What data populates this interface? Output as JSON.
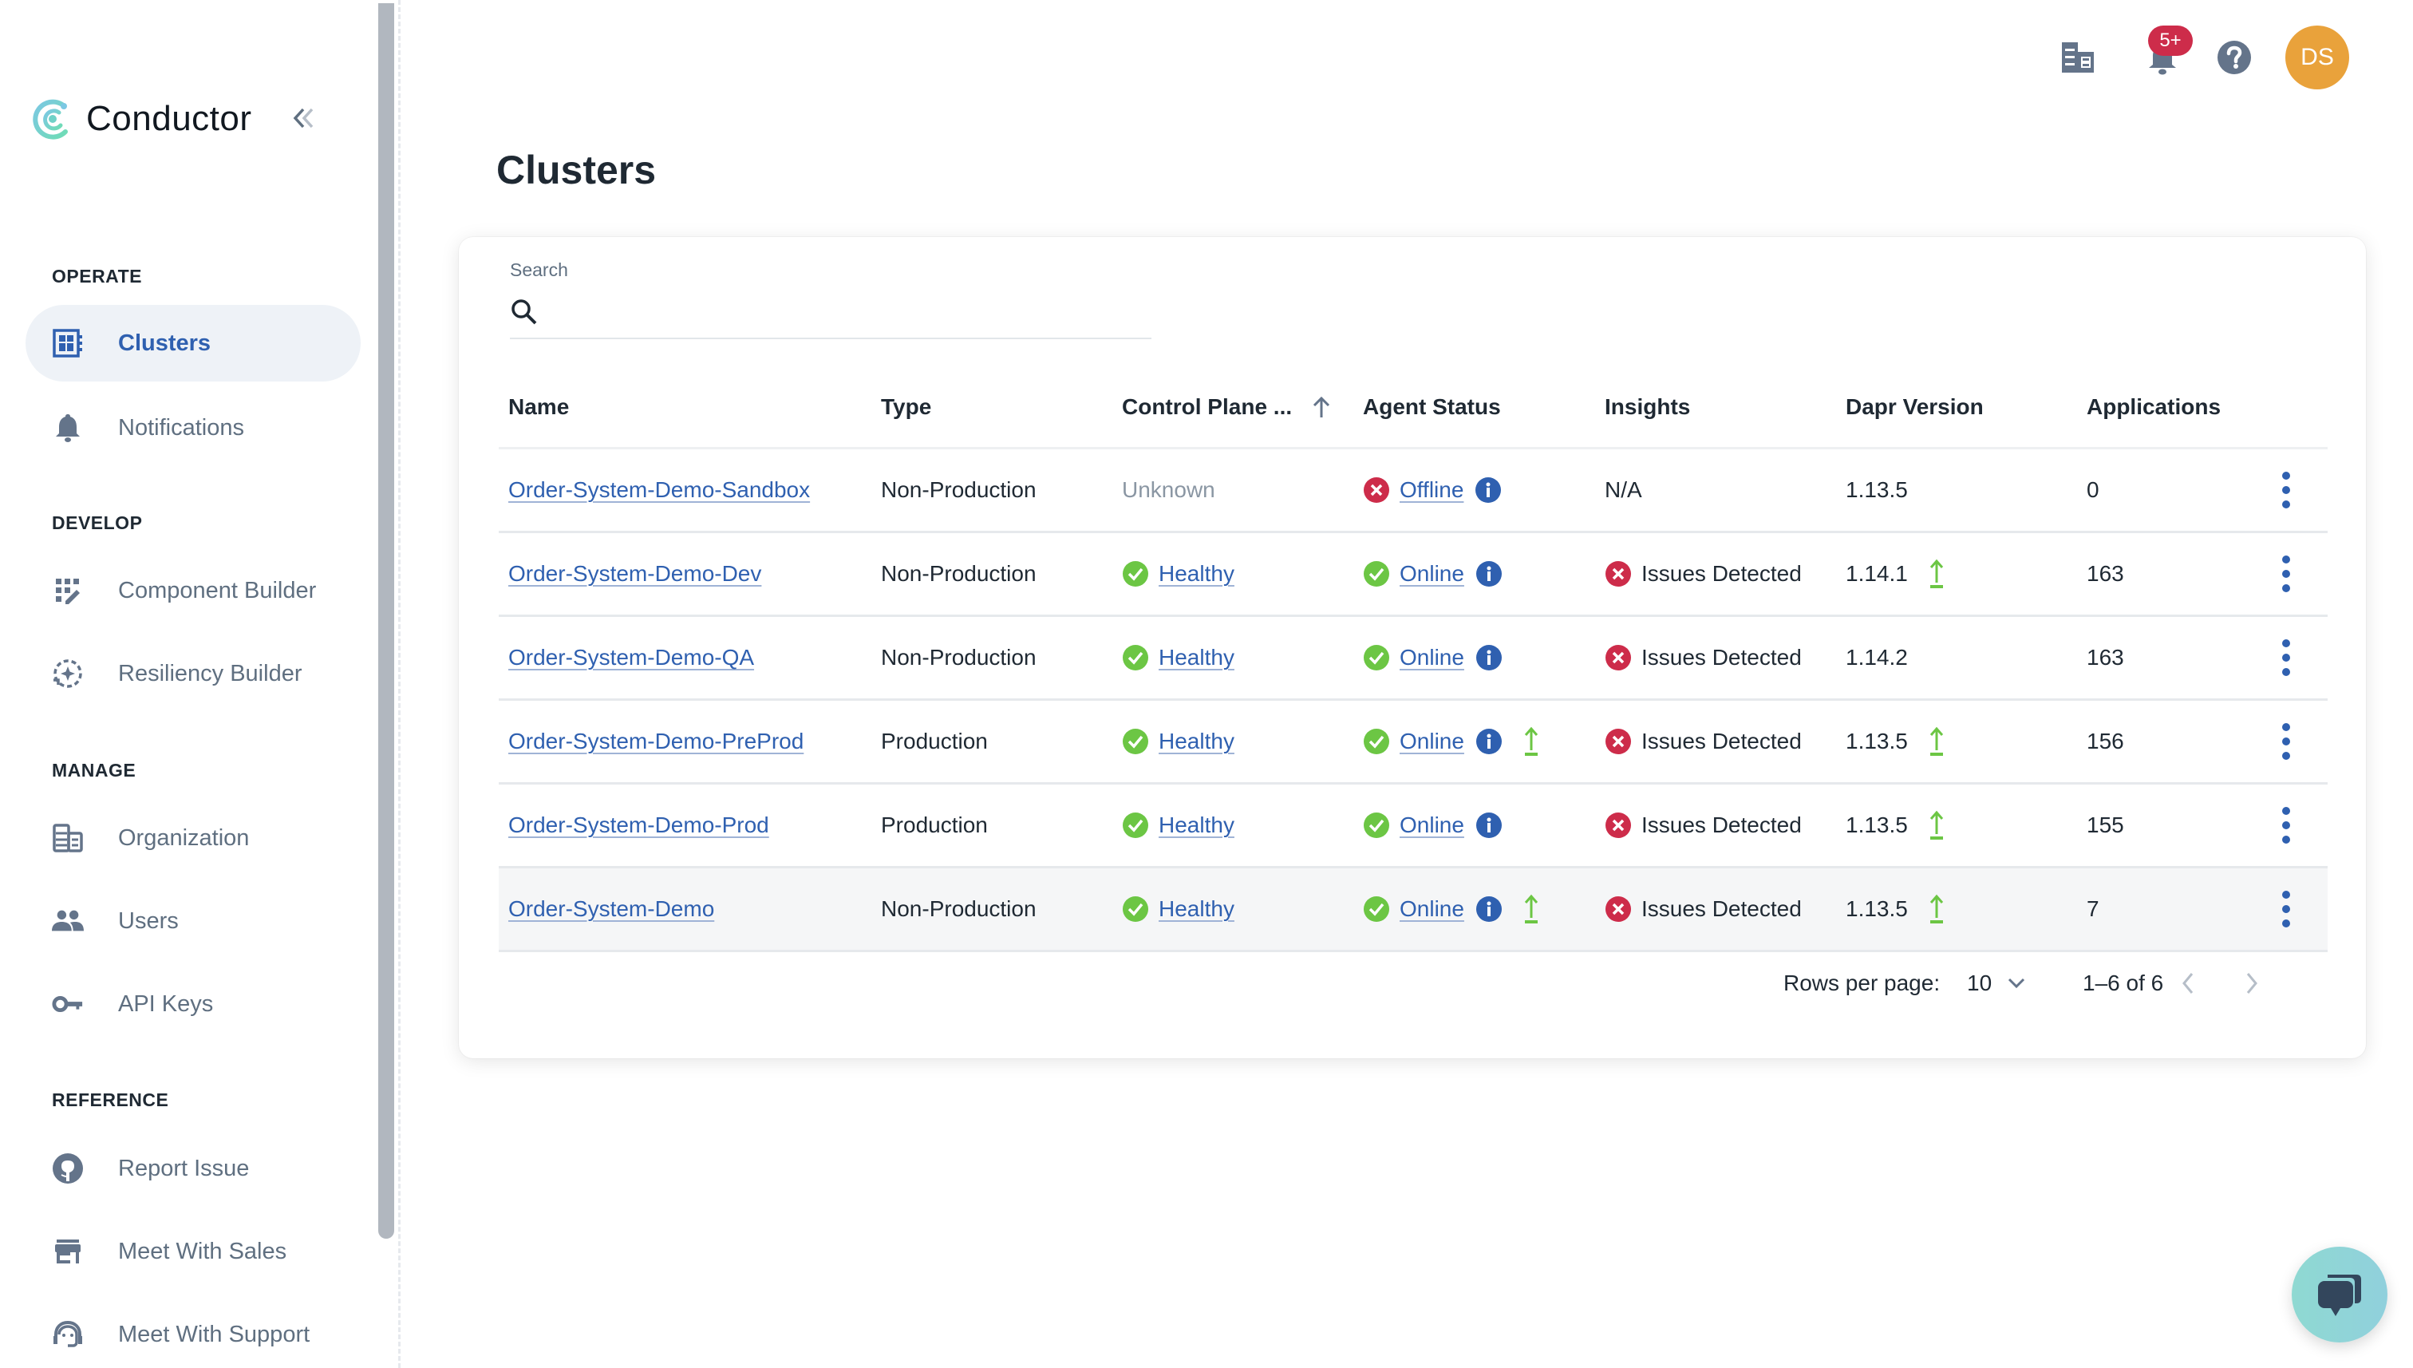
{
  "app": {
    "name": "Conductor",
    "collapse_label": "Collapse sidebar"
  },
  "sidebar": {
    "sections": [
      {
        "label": "OPERATE",
        "items": [
          {
            "label": "Clusters",
            "icon": "clusters-icon",
            "active": true
          },
          {
            "label": "Notifications",
            "icon": "bell-icon",
            "active": false
          }
        ]
      },
      {
        "label": "DEVELOP",
        "items": [
          {
            "label": "Component Builder",
            "icon": "component-builder-icon",
            "active": false
          },
          {
            "label": "Resiliency Builder",
            "icon": "resiliency-builder-icon",
            "active": false
          }
        ]
      },
      {
        "label": "MANAGE",
        "items": [
          {
            "label": "Organization",
            "icon": "organization-icon",
            "active": false
          },
          {
            "label": "Users",
            "icon": "users-icon",
            "active": false
          },
          {
            "label": "API Keys",
            "icon": "key-icon",
            "active": false
          }
        ]
      },
      {
        "label": "REFERENCE",
        "items": [
          {
            "label": "Report Issue",
            "icon": "github-icon",
            "active": false
          },
          {
            "label": "Meet With Sales",
            "icon": "store-icon",
            "active": false
          },
          {
            "label": "Meet With Support",
            "icon": "support-agent-icon",
            "active": false
          }
        ]
      }
    ]
  },
  "topbar": {
    "notifications_badge": "5+",
    "avatar_initials": "DS"
  },
  "page": {
    "title": "Clusters"
  },
  "search": {
    "label": "Search",
    "value": "",
    "placeholder": ""
  },
  "table": {
    "columns": [
      "Name",
      "Type",
      "Control Plane ...",
      "Agent Status",
      "Insights",
      "Dapr Version",
      "Applications"
    ],
    "sorted_column": "Control Plane ...",
    "sort_direction": "ascending",
    "rows": [
      {
        "name": "Order-System-Demo-Sandbox",
        "type": "Non-Production",
        "control_plane": "Unknown",
        "control_plane_status": "unknown",
        "agent_status": "Offline",
        "agent_state": "error",
        "agent_upgrade": false,
        "insights": "N/A",
        "insights_state": "none",
        "dapr_version": "1.13.5",
        "dapr_upgrade": false,
        "applications": "0"
      },
      {
        "name": "Order-System-Demo-Dev",
        "type": "Non-Production",
        "control_plane": "Healthy",
        "control_plane_status": "ok",
        "agent_status": "Online",
        "agent_state": "ok",
        "agent_upgrade": false,
        "insights": "Issues Detected",
        "insights_state": "error",
        "dapr_version": "1.14.1",
        "dapr_upgrade": true,
        "applications": "163"
      },
      {
        "name": "Order-System-Demo-QA",
        "type": "Non-Production",
        "control_plane": "Healthy",
        "control_plane_status": "ok",
        "agent_status": "Online",
        "agent_state": "ok",
        "agent_upgrade": false,
        "insights": "Issues Detected",
        "insights_state": "error",
        "dapr_version": "1.14.2",
        "dapr_upgrade": false,
        "applications": "163"
      },
      {
        "name": "Order-System-Demo-PreProd",
        "type": "Production",
        "control_plane": "Healthy",
        "control_plane_status": "ok",
        "agent_status": "Online",
        "agent_state": "ok",
        "agent_upgrade": true,
        "insights": "Issues Detected",
        "insights_state": "error",
        "dapr_version": "1.13.5",
        "dapr_upgrade": true,
        "applications": "156"
      },
      {
        "name": "Order-System-Demo-Prod",
        "type": "Production",
        "control_plane": "Healthy",
        "control_plane_status": "ok",
        "agent_status": "Online",
        "agent_state": "ok",
        "agent_upgrade": false,
        "insights": "Issues Detected",
        "insights_state": "error",
        "dapr_version": "1.13.5",
        "dapr_upgrade": true,
        "applications": "155"
      },
      {
        "name": "Order-System-Demo",
        "type": "Non-Production",
        "control_plane": "Healthy",
        "control_plane_status": "ok",
        "agent_status": "Online",
        "agent_state": "ok",
        "agent_upgrade": true,
        "insights": "Issues Detected",
        "insights_state": "error",
        "dapr_version": "1.13.5",
        "dapr_upgrade": true,
        "applications": "7"
      }
    ]
  },
  "pagination": {
    "rows_per_page_label": "Rows per page:",
    "rows_per_page": "10",
    "range": "1–6 of 6"
  },
  "colors": {
    "accent": "#2f60b0",
    "success": "#6cc644",
    "error": "#cd2c4a",
    "avatar": "#e9a23b",
    "badge": "#cd2c4a",
    "icon_gray": "#64748a",
    "upgrade": "#6cc644",
    "chat_fab": "#8fd9d2"
  }
}
